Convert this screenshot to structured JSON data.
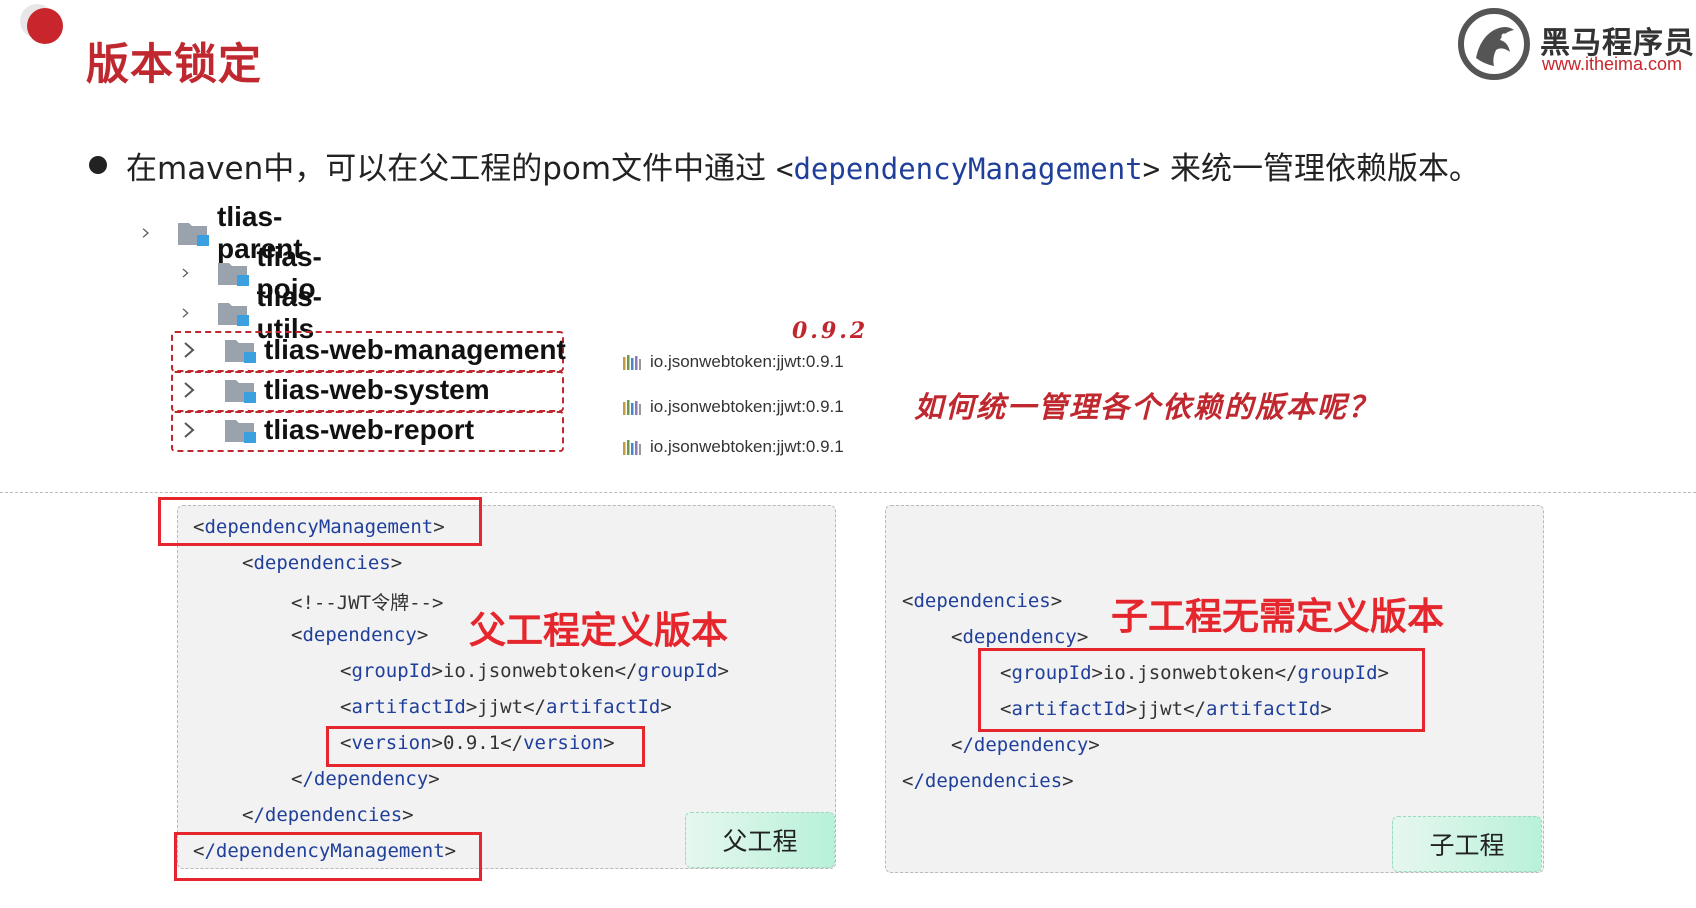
{
  "page": {
    "title": "版本锁定",
    "logo": {
      "cn": "黑马程序员",
      "url": "www.itheima.com"
    },
    "intro": {
      "before": "在maven中，可以在父工程的pom文件中通过",
      "tag_open": "<",
      "tag_name": "dependencyManagement",
      "tag_close": ">",
      "after": "来统一管理依赖版本。"
    }
  },
  "tree": {
    "items": [
      {
        "label": "tlias-parent",
        "level": 0
      },
      {
        "label": "tlias-pojo",
        "level": 1
      },
      {
        "label": "tlias-utils",
        "level": 1
      },
      {
        "label": "tlias-web-management",
        "level": 1,
        "dep": "io.jsonwebtoken:jjwt:0.9.1"
      },
      {
        "label": "tlias-web-system",
        "level": 1,
        "dep": "io.jsonwebtoken:jjwt:0.9.1"
      },
      {
        "label": "tlias-web-report",
        "level": 1,
        "dep": "io.jsonwebtoken:jjwt:0.9.1"
      }
    ]
  },
  "annotations": {
    "version_note": "0.9.2",
    "question": "如何统一管理各个依赖的版本呢？"
  },
  "parent_panel": {
    "label": "父工程",
    "heading": "父工程定义版本",
    "lines": {
      "dm_open_name": "dependencyManagement",
      "deps_open_name": "dependencies",
      "comment": "<!--JWT令牌-->",
      "dep_open_name": "dependency",
      "groupId_tag": "groupId",
      "groupId_val": "io.jsonwebtoken",
      "artifactId_tag": "artifactId",
      "artifactId_val": "jjwt",
      "version_tag": "version",
      "version_val": "0.9.1",
      "dep_close_name": "/dependency",
      "deps_close_name": "/dependencies",
      "dm_close_name": "/dependencyManagement"
    }
  },
  "child_panel": {
    "label": "子工程",
    "heading": "子工程无需定义版本",
    "lines": {
      "deps_open_name": "dependencies",
      "dep_open_name": "dependency",
      "groupId_tag": "groupId",
      "groupId_val": "io.jsonwebtoken",
      "artifactId_tag": "artifactId",
      "artifactId_val": "jjwt",
      "dep_close_name": "/dependency",
      "deps_close_name": "/dependencies"
    }
  },
  "colors": {
    "accent_red": "#e5262d",
    "title_red": "#c0282f",
    "xml_tag_blue": "#1f3f9a"
  }
}
